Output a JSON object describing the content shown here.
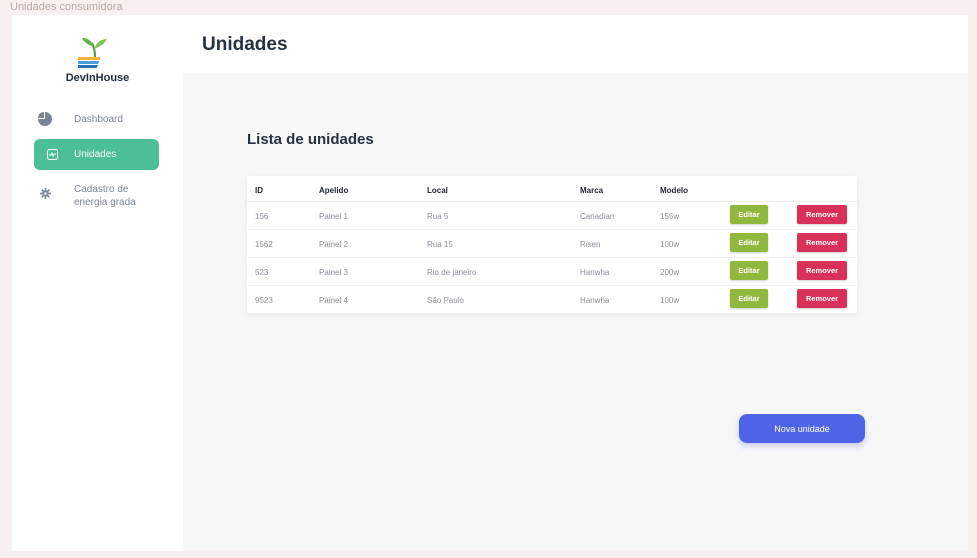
{
  "frame_label": "Unidades consumidora",
  "brand": "DevInHouse",
  "sidebar": {
    "items": [
      {
        "label": "Dashboard",
        "icon": "pie-chart-icon"
      },
      {
        "label": "Unidades",
        "icon": "unit-icon",
        "active": true
      },
      {
        "label_line1": "Cadastro de",
        "label_line2": "energia grada",
        "icon": "gear-icon"
      }
    ]
  },
  "header": {
    "title": "Unidades"
  },
  "main": {
    "section_title": "Lista de unidades",
    "table": {
      "headers": {
        "id": "ID",
        "apelido": "Apelido",
        "local": "Local",
        "marca": "Marca",
        "modelo": "Modelo"
      },
      "rows": [
        {
          "id": "156",
          "apelido": "Painel 1",
          "local": "Rua 5",
          "marca": "Canadian",
          "modelo": "155w",
          "edit": "Editar",
          "remove": "Remover"
        },
        {
          "id": "1562",
          "apelido": "Painel 2",
          "local": "Rua 15",
          "marca": "Risen",
          "modelo": "100w",
          "edit": "Editar",
          "remove": "Remover"
        },
        {
          "id": "523",
          "apelido": "Painel 3",
          "local": "Rio de janeiro",
          "marca": "Hanwha",
          "modelo": "200w",
          "edit": "Editar",
          "remove": "Remover"
        },
        {
          "id": "9523",
          "apelido": "Painel 4",
          "local": "São Paulo",
          "marca": "Hanwha",
          "modelo": "100w",
          "edit": "Editar",
          "remove": "Remover"
        }
      ]
    },
    "new_button": "Nova unidade"
  },
  "colors": {
    "accent": "#4cbf96",
    "edit": "#8fb93c",
    "remove": "#d9305a",
    "primary": "#4f63e8"
  }
}
